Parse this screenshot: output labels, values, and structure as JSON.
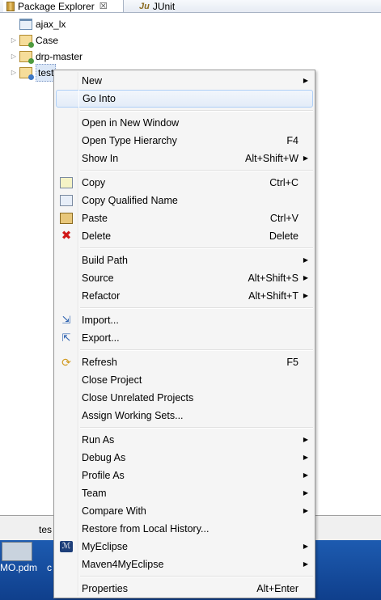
{
  "tabs": [
    {
      "label": "Package Explorer",
      "close": "☒",
      "active": true
    },
    {
      "label": "JUnit",
      "icon_text": "Ju",
      "active": false
    }
  ],
  "tree": [
    {
      "label": "ajax_lx",
      "icon": "folder-icon",
      "expandable": false
    },
    {
      "label": "Case",
      "icon": "project-icon",
      "expandable": true
    },
    {
      "label": "drp-master",
      "icon": "project-icon",
      "expandable": true
    },
    {
      "label": "test",
      "icon": "java-project-icon",
      "expandable": true,
      "selected": true
    }
  ],
  "bottom": {
    "text": "tes"
  },
  "desktop": {
    "file_label": "MO.pdm",
    "file_label2": "c"
  },
  "menu": {
    "groups": [
      [
        {
          "label": "New",
          "accel": "",
          "submenu": true,
          "icon": ""
        },
        {
          "label": "Go Into",
          "accel": "",
          "submenu": false,
          "icon": "",
          "hover": true
        }
      ],
      [
        {
          "label": "Open in New Window",
          "accel": "",
          "submenu": false,
          "icon": ""
        },
        {
          "label": "Open Type Hierarchy",
          "accel": "F4",
          "submenu": false,
          "icon": ""
        },
        {
          "label": "Show In",
          "accel": "Alt+Shift+W",
          "submenu": true,
          "icon": ""
        }
      ],
      [
        {
          "label": "Copy",
          "accel": "Ctrl+C",
          "submenu": false,
          "icon": "copy-icon"
        },
        {
          "label": "Copy Qualified Name",
          "accel": "",
          "submenu": false,
          "icon": "copy-qualified-name-icon"
        },
        {
          "label": "Paste",
          "accel": "Ctrl+V",
          "submenu": false,
          "icon": "paste-icon"
        },
        {
          "label": "Delete",
          "accel": "Delete",
          "submenu": false,
          "icon": "delete-icon"
        }
      ],
      [
        {
          "label": "Build Path",
          "accel": "",
          "submenu": true,
          "icon": ""
        },
        {
          "label": "Source",
          "accel": "Alt+Shift+S",
          "submenu": true,
          "icon": ""
        },
        {
          "label": "Refactor",
          "accel": "Alt+Shift+T",
          "submenu": true,
          "icon": ""
        }
      ],
      [
        {
          "label": "Import...",
          "accel": "",
          "submenu": false,
          "icon": "import-icon"
        },
        {
          "label": "Export...",
          "accel": "",
          "submenu": false,
          "icon": "export-icon"
        }
      ],
      [
        {
          "label": "Refresh",
          "accel": "F5",
          "submenu": false,
          "icon": "refresh-icon"
        },
        {
          "label": "Close Project",
          "accel": "",
          "submenu": false,
          "icon": ""
        },
        {
          "label": "Close Unrelated Projects",
          "accel": "",
          "submenu": false,
          "icon": ""
        },
        {
          "label": "Assign Working Sets...",
          "accel": "",
          "submenu": false,
          "icon": ""
        }
      ],
      [
        {
          "label": "Run As",
          "accel": "",
          "submenu": true,
          "icon": ""
        },
        {
          "label": "Debug As",
          "accel": "",
          "submenu": true,
          "icon": ""
        },
        {
          "label": "Profile As",
          "accel": "",
          "submenu": true,
          "icon": ""
        },
        {
          "label": "Team",
          "accel": "",
          "submenu": true,
          "icon": ""
        },
        {
          "label": "Compare With",
          "accel": "",
          "submenu": true,
          "icon": ""
        },
        {
          "label": "Restore from Local History...",
          "accel": "",
          "submenu": false,
          "icon": ""
        },
        {
          "label": "MyEclipse",
          "accel": "",
          "submenu": true,
          "icon": "myeclipse-icon"
        },
        {
          "label": "Maven4MyEclipse",
          "accel": "",
          "submenu": true,
          "icon": ""
        }
      ],
      [
        {
          "label": "Properties",
          "accel": "Alt+Enter",
          "submenu": false,
          "icon": ""
        }
      ]
    ]
  }
}
